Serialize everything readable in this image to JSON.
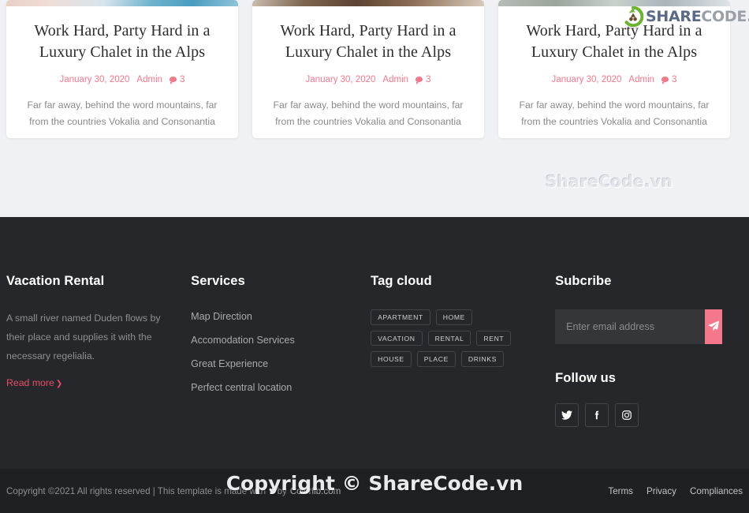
{
  "blog": {
    "cards": [
      {
        "image_name": "chalet-alps-photo-1",
        "title": "Work Hard, Party Hard in a Luxury Chalet in the Alps",
        "date": "January 30, 2020",
        "author": "Admin",
        "comments": "3",
        "excerpt": "Far far away, behind the word mountains, far from the countries Vokalia and Consonantia"
      },
      {
        "image_name": "chalet-alps-photo-2",
        "title": "Work Hard, Party Hard in a Luxury Chalet in the Alps",
        "date": "January 30, 2020",
        "author": "Admin",
        "comments": "3",
        "excerpt": "Far far away, behind the word mountains, far from the countries Vokalia and Consonantia"
      },
      {
        "image_name": "chalet-alps-photo-3",
        "title": "Work Hard, Party Hard in a Luxury Chalet in the Alps",
        "date": "January 30, 2020",
        "author": "Admin",
        "comments": "3",
        "excerpt": "Far far away, behind the word mountains, far from the countries Vokalia and Consonantia"
      }
    ]
  },
  "watermarks": {
    "logo_share": "SHARE",
    "logo_code": "CODE.vn",
    "center": "ShareCode.vn",
    "bottom": "Copyright © ShareCode.vn"
  },
  "footer": {
    "about": {
      "title": "Vacation Rental",
      "text": "A small river named Duden flows by their place and supplies it with the necessary regelialia.",
      "read_more": "Read more",
      "chevron": "❯"
    },
    "services": {
      "title": "Services",
      "items": [
        "Map Direction",
        "Accomodation Services",
        "Great Experience",
        "Perfect central location"
      ]
    },
    "tag_cloud": {
      "title": "Tag cloud",
      "tags": [
        "APARTMENT",
        "HOME",
        "VACATION",
        "RENTAL",
        "RENT",
        "HOUSE",
        "PLACE",
        "DRINKS"
      ]
    },
    "subscribe": {
      "title": "Subcribe",
      "placeholder": "Enter email address",
      "value": "",
      "button_icon": "paper-plane-icon"
    },
    "follow": {
      "title": "Follow us",
      "socials": [
        "twitter-icon",
        "facebook-icon",
        "instagram-icon"
      ]
    }
  },
  "bottom_bar": {
    "copyright_prefix": "Copyright ©2021 All rights reserved | This template is made with",
    "heart": "♥",
    "copyright_by": "by",
    "brand": "Colorlib.com",
    "links": [
      "Terms",
      "Privacy",
      "Compliances"
    ]
  },
  "colors": {
    "accent_pink": "#f4778c",
    "accent_crimson": "#e74c6a",
    "footer_bg": "#26272b",
    "bottom_bg": "#1f2023",
    "page_bg": "#f0f1f5"
  }
}
